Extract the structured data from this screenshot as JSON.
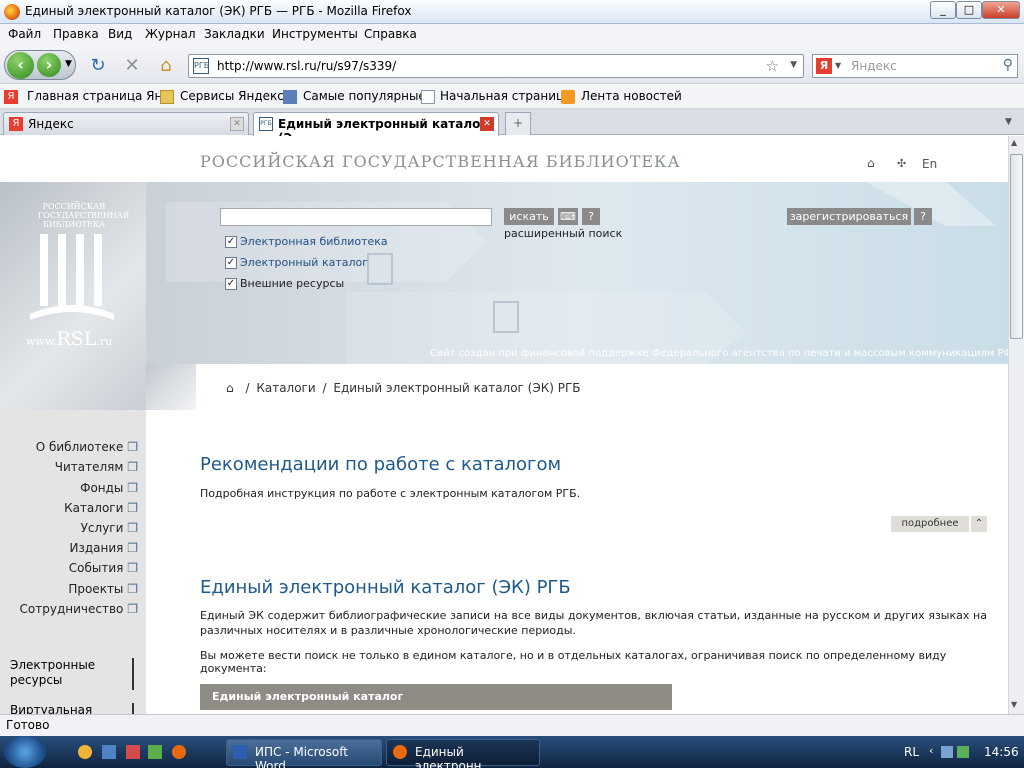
{
  "window": {
    "title": "Единый электронный каталог (ЭК) РГБ — РГБ - Mozilla Firefox",
    "controls": [
      "_",
      "□",
      "✕"
    ]
  },
  "menu": [
    "Файл",
    "Правка",
    "Вид",
    "Журнал",
    "Закладки",
    "Инструменты",
    "Справка"
  ],
  "navbar": {
    "url": "http://www.rsl.ru/ru/s97/s339/",
    "search_placeholder": "Яндекс"
  },
  "bookmarks": [
    {
      "label": "Главная страница Ян...",
      "icon": "yandex-icon"
    },
    {
      "label": "Сервисы Яндекса",
      "icon": "folder-icon"
    },
    {
      "label": "Самые популярные",
      "icon": "popular-icon"
    },
    {
      "label": "Начальная страница",
      "icon": "page-icon"
    },
    {
      "label": "Лента новостей",
      "icon": "rss-icon"
    }
  ],
  "tabs": [
    {
      "label": "Яндекс",
      "active": false
    },
    {
      "label": "Единый электронный каталог (Э...",
      "active": true
    }
  ],
  "site": {
    "header_title": "РОССИЙСКАЯ ГОСУДАРСТВЕННАЯ БИБЛИОТЕКА",
    "lang_link": "En",
    "logo_line1": "РОССИЙСКАЯ",
    "logo_line2": "ГОСУДАРСТВЕННАЯ",
    "logo_line3": "БИБЛИОТЕКА",
    "logo_url_www": "www.",
    "logo_url_rsl": "RSL",
    "logo_url_ru": ".ru",
    "search": {
      "value": "",
      "button": "искать",
      "help": "?",
      "advanced": "расширенный поиск",
      "options": [
        {
          "label": "Электронная библиотека",
          "checked": true
        },
        {
          "label": "Электронный каталог",
          "checked": true
        },
        {
          "label": "Внешние ресурсы",
          "checked": true
        }
      ]
    },
    "register_button": "зарегистрироваться",
    "register_help": "?",
    "sponsor": "Сайт создан при финансовой поддержке Федерального агентства по печати и массовым коммуникациям РФ",
    "breadcrumb": [
      "Каталоги",
      "Единый электронный каталог (ЭК) РГБ"
    ],
    "breadcrumb_sep": "/",
    "left_nav": [
      "О библиотеке",
      "Читателям",
      "Фонды",
      "Каталоги",
      "Услуги",
      "Издания",
      "События",
      "Проекты",
      "Сотрудничество"
    ],
    "left_links": [
      "Электронные ресурсы",
      "Виртуальная"
    ],
    "section1": {
      "heading": "Рекомендации по работе с каталогом",
      "text": "Подробная инструкция по работе с электронным каталогом РГБ.",
      "more": "подробнее"
    },
    "section2": {
      "heading": "Единый электронный каталог (ЭК) РГБ",
      "p1": "Единый ЭК содержит библиографические записи на все виды документов, включая статьи, изданные на русском и других языках на различных носителях и в различные хронологические периоды.",
      "p2": "Вы можете вести поиск не только в едином каталоге, но и в отдельных каталогах, ограничивая поиск по определенному виду документа:",
      "box_title": "Единый электронный каталог"
    }
  },
  "status": "Готово",
  "taskbar": {
    "items": [
      {
        "label": "ИПС - Microsoft Word",
        "active": false
      },
      {
        "label": "Единый электронн...",
        "active": true
      }
    ],
    "lang": "RL",
    "time": "14:56"
  },
  "colors": {
    "link_blue": "#1f4f86",
    "heading_blue": "#1e5a8c",
    "gray_button": "#8a8a8a"
  }
}
